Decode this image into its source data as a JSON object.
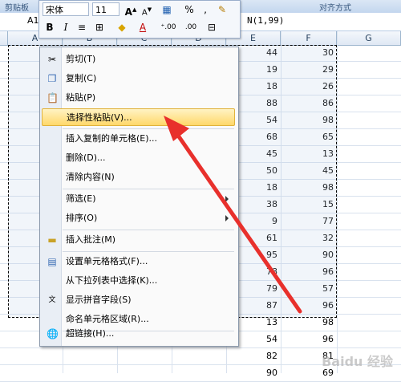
{
  "ribbon": {
    "group_left": "剪贴板",
    "group_right": "对齐方式"
  },
  "formula_bar": {
    "name_box": "A1",
    "formula": "N(1,99)"
  },
  "mini_toolbar": {
    "font_name": "宋体",
    "font_size": "11",
    "bold": "B",
    "italic": "I",
    "align": "≡",
    "font_color": "A",
    "percent": "%",
    "comma": ",",
    "dec_inc": "⁺.00",
    "dec_dec": ".00"
  },
  "columns": [
    "A",
    "B",
    "C",
    "D",
    "E",
    "F",
    "G"
  ],
  "cells": [
    [
      "44",
      "30"
    ],
    [
      "19",
      "29"
    ],
    [
      "18",
      "26"
    ],
    [
      "88",
      "86"
    ],
    [
      "54",
      "98"
    ],
    [
      "68",
      "65"
    ],
    [
      "45",
      "13"
    ],
    [
      "50",
      "45"
    ],
    [
      "18",
      "98"
    ],
    [
      "38",
      "15"
    ],
    [
      "9",
      "77"
    ],
    [
      "61",
      "32"
    ],
    [
      "95",
      "90"
    ],
    [
      "78",
      "96"
    ],
    [
      "79",
      "57"
    ],
    [
      "87",
      "96"
    ],
    [
      "13",
      "98"
    ],
    [
      "54",
      "96"
    ],
    [
      "82",
      "81"
    ],
    [
      "90",
      "69"
    ]
  ],
  "context_menu": {
    "items": [
      {
        "label": "剪切(T)",
        "icon": "scissors-icon"
      },
      {
        "label": "复制(C)",
        "icon": "copy-icon"
      },
      {
        "label": "粘贴(P)",
        "icon": "paste-icon"
      },
      {
        "label": "选择性粘贴(V)...",
        "icon": ""
      },
      {
        "label": "插入复制的单元格(E)...",
        "icon": ""
      },
      {
        "label": "删除(D)...",
        "icon": ""
      },
      {
        "label": "清除内容(N)",
        "icon": ""
      },
      {
        "label": "筛选(E)",
        "icon": ""
      },
      {
        "label": "排序(O)",
        "icon": ""
      },
      {
        "label": "插入批注(M)",
        "icon": "comment-icon"
      },
      {
        "label": "设置单元格格式(F)...",
        "icon": "format-cells-icon"
      },
      {
        "label": "从下拉列表中选择(K)...",
        "icon": ""
      },
      {
        "label": "显示拼音字段(S)",
        "icon": "phonetic-icon"
      },
      {
        "label": "命名单元格区域(R)...",
        "icon": ""
      },
      {
        "label": "超链接(H)...",
        "icon": "hyperlink-icon"
      }
    ]
  },
  "watermark": "Baidu 经验"
}
